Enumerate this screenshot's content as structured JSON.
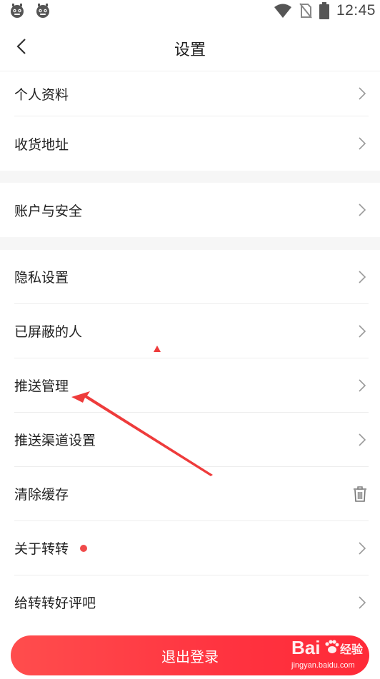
{
  "status_bar": {
    "time": "12:45",
    "icons": [
      "android-robot-icon",
      "android-robot-icon",
      "wifi-icon",
      "no-sim-icon",
      "battery-icon"
    ]
  },
  "header": {
    "title": "设置",
    "back_icon": "chevron-left-icon"
  },
  "groups": [
    {
      "items": [
        {
          "label": "个人资料",
          "action_icon": "chevron-right-icon"
        },
        {
          "label": "收货地址",
          "action_icon": "chevron-right-icon"
        }
      ]
    },
    {
      "items": [
        {
          "label": "账户与安全",
          "action_icon": "chevron-right-icon"
        }
      ]
    },
    {
      "items": [
        {
          "label": "隐私设置",
          "action_icon": "chevron-right-icon"
        },
        {
          "label": "已屏蔽的人",
          "action_icon": "chevron-right-icon"
        },
        {
          "label": "推送管理",
          "action_icon": "chevron-right-icon"
        },
        {
          "label": "推送渠道设置",
          "action_icon": "chevron-right-icon"
        },
        {
          "label": "清除缓存",
          "action_icon": "trash-icon"
        },
        {
          "label": "关于转转",
          "action_icon": "chevron-right-icon",
          "badge": "red-dot"
        },
        {
          "label": "给转转好评吧",
          "action_icon": "chevron-right-icon"
        }
      ]
    }
  ],
  "logout_label": "退出登录",
  "annotation": {
    "type": "arrow",
    "color": "#ee3b3b"
  },
  "watermark": {
    "brand": "Bai",
    "brand_suffix": "经验",
    "url": "jingyan.baidu.com"
  },
  "colors": {
    "accent": "#ff3b3b",
    "separator": "#ededed",
    "group_gap": "#f6f6f6",
    "badge": "#f04a4a"
  }
}
